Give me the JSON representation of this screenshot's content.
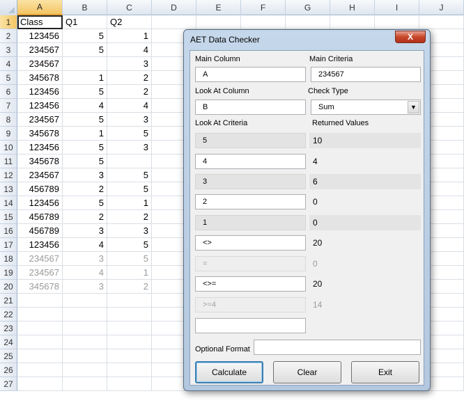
{
  "sheet": {
    "columns": [
      "A",
      "B",
      "C",
      "D",
      "E",
      "F",
      "G",
      "H",
      "I",
      "J"
    ],
    "rows": [
      {
        "n": "1",
        "a": "Class",
        "b": "Q1",
        "c": "Q2"
      },
      {
        "n": "2",
        "a": "123456",
        "b": "5",
        "c": "1"
      },
      {
        "n": "3",
        "a": "234567",
        "b": "5",
        "c": "4"
      },
      {
        "n": "4",
        "a": "234567",
        "b": "",
        "c": "3"
      },
      {
        "n": "5",
        "a": "345678",
        "b": "1",
        "c": "2"
      },
      {
        "n": "6",
        "a": "123456",
        "b": "5",
        "c": "2"
      },
      {
        "n": "7",
        "a": "123456",
        "b": "4",
        "c": "4"
      },
      {
        "n": "8",
        "a": "234567",
        "b": "5",
        "c": "3"
      },
      {
        "n": "9",
        "a": "345678",
        "b": "1",
        "c": "5"
      },
      {
        "n": "10",
        "a": "123456",
        "b": "5",
        "c": "3"
      },
      {
        "n": "11",
        "a": "345678",
        "b": "5",
        "c": ""
      },
      {
        "n": "12",
        "a": "234567",
        "b": "3",
        "c": "5"
      },
      {
        "n": "13",
        "a": "456789",
        "b": "2",
        "c": "5"
      },
      {
        "n": "14",
        "a": "123456",
        "b": "5",
        "c": "1"
      },
      {
        "n": "15",
        "a": "456789",
        "b": "2",
        "c": "2"
      },
      {
        "n": "16",
        "a": "456789",
        "b": "3",
        "c": "3"
      },
      {
        "n": "17",
        "a": "123456",
        "b": "4",
        "c": "5"
      },
      {
        "n": "18",
        "a": "234567",
        "b": "3",
        "c": "5"
      },
      {
        "n": "19",
        "a": "234567",
        "b": "4",
        "c": "1"
      },
      {
        "n": "20",
        "a": "345678",
        "b": "3",
        "c": "2"
      },
      {
        "n": "21",
        "a": "",
        "b": "",
        "c": ""
      },
      {
        "n": "22",
        "a": "",
        "b": "",
        "c": ""
      },
      {
        "n": "23",
        "a": "",
        "b": "",
        "c": ""
      },
      {
        "n": "24",
        "a": "",
        "b": "",
        "c": ""
      },
      {
        "n": "25",
        "a": "",
        "b": "",
        "c": ""
      },
      {
        "n": "26",
        "a": "",
        "b": "",
        "c": ""
      },
      {
        "n": "27",
        "a": "",
        "b": "",
        "c": ""
      }
    ]
  },
  "dialog": {
    "title": "AET Data Checker",
    "close_label": "X",
    "main_column_label": "Main Column",
    "main_column_value": "A",
    "main_criteria_label": "Main Criteria",
    "main_criteria_value": "234567",
    "look_at_column_label": "Look At Column",
    "look_at_column_value": "B",
    "check_type_label": "Check Type",
    "check_type_value": "Sum",
    "look_at_criteria_label": "Look At Criteria",
    "returned_values_label": "Returned Values",
    "criteria_rows": [
      {
        "criteria": "5",
        "value": "10"
      },
      {
        "criteria": "4",
        "value": "4"
      },
      {
        "criteria": "3",
        "value": "6"
      },
      {
        "criteria": "2",
        "value": "0"
      },
      {
        "criteria": "1",
        "value": "0"
      },
      {
        "criteria": "<>",
        "value": "20"
      },
      {
        "criteria": "=",
        "value": "0"
      },
      {
        "criteria": "<>=",
        "value": "20"
      },
      {
        "criteria": ">=4",
        "value": "14"
      },
      {
        "criteria": "",
        "value": ""
      }
    ],
    "optional_format_label": "Optional Format",
    "optional_format_value": "",
    "calculate_label": "Calculate",
    "clear_label": "Clear",
    "exit_label": "Exit"
  }
}
